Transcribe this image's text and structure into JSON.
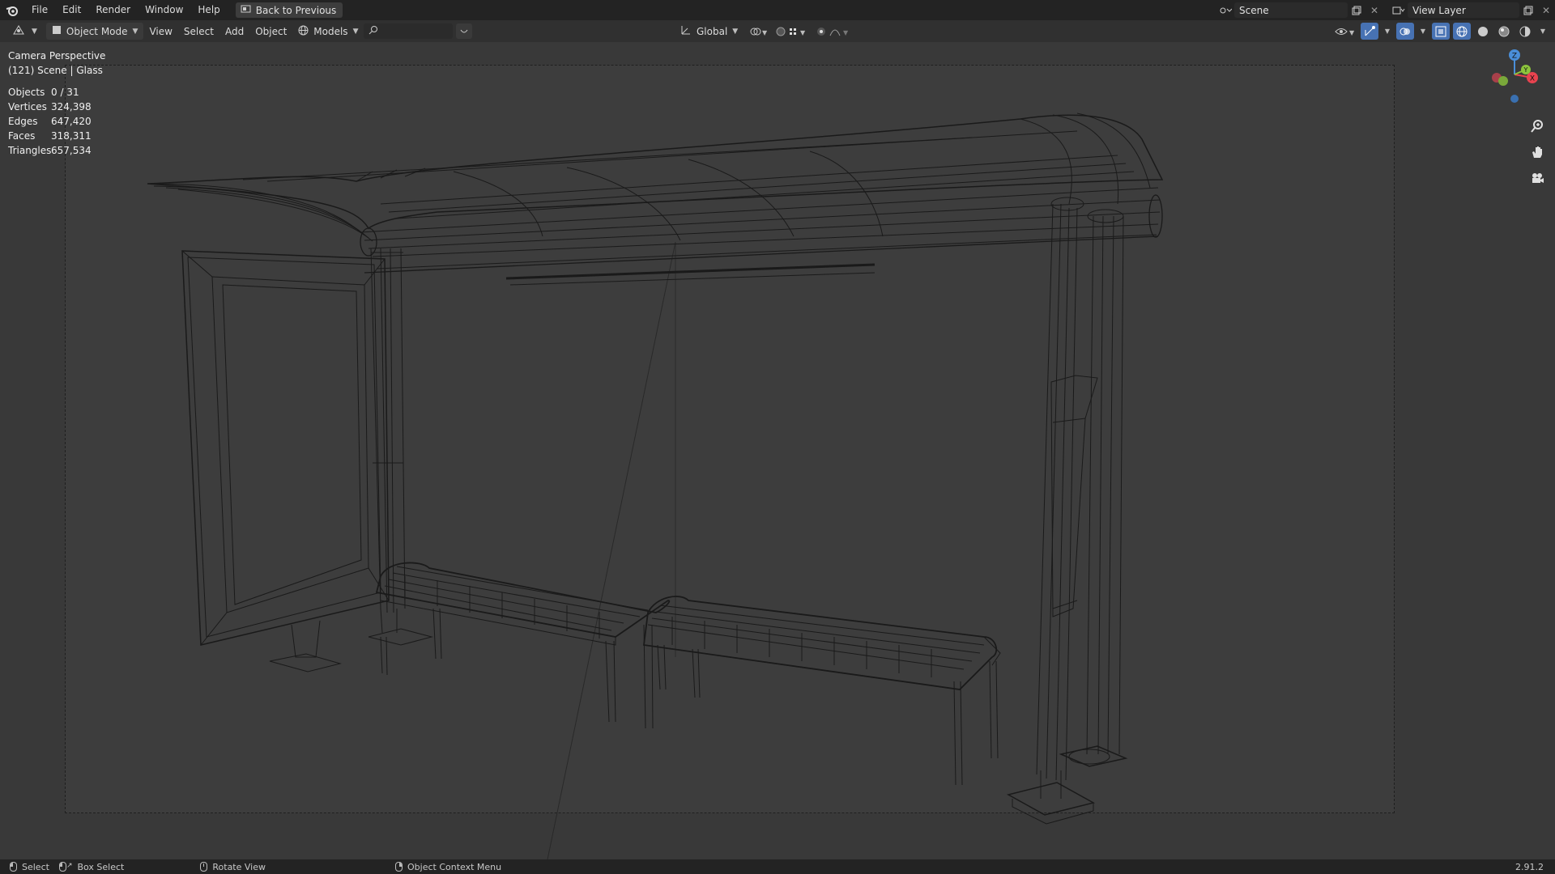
{
  "topbar": {
    "menus": [
      "File",
      "Edit",
      "Render",
      "Window",
      "Help"
    ],
    "back_button": "Back to Previous",
    "scene_name": "Scene",
    "view_layer": "View Layer"
  },
  "header": {
    "mode": "Object Mode",
    "menus": [
      "View",
      "Select",
      "Add",
      "Object"
    ],
    "collection": "Models",
    "search_placeholder": "",
    "transform_orientation": "Global"
  },
  "viewport": {
    "view_name": "Camera Perspective",
    "scene_info": "(121) Scene | Glass",
    "stats": [
      {
        "label": "Objects",
        "value": "0 / 31"
      },
      {
        "label": "Vertices",
        "value": "324,398"
      },
      {
        "label": "Edges",
        "value": "647,420"
      },
      {
        "label": "Faces",
        "value": "318,311"
      },
      {
        "label": "Triangles",
        "value": "657,534"
      }
    ],
    "gizmo": {
      "z": "Z",
      "y": "Y",
      "x": "X"
    }
  },
  "statusbar": {
    "select": "Select",
    "box_select": "Box Select",
    "rotate": "Rotate View",
    "context": "Object Context Menu",
    "version": "2.91.2"
  },
  "colors": {
    "accent": "#4772b3",
    "gizmo_x": "#e8434f",
    "gizmo_y": "#8cc43c",
    "gizmo_z": "#4a8ed8"
  }
}
